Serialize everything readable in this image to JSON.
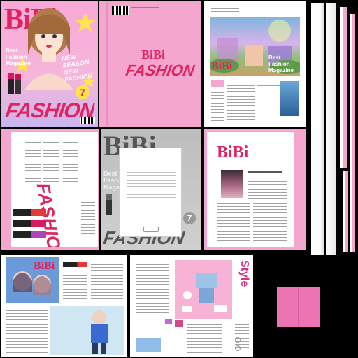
{
  "atlas": {
    "background": "#000000",
    "accent": "#e0245e",
    "pink": "#f4a6cf",
    "cover_bg": "#f7b3d6"
  },
  "cover": {
    "brand": "BiBi",
    "tagline_line1": "Best",
    "tagline_line2": "Fashion",
    "tagline_line3": "Magazine",
    "season_line1": "NEW",
    "season_line2": "SEASON",
    "season_line3": "NEW",
    "season_line4": "FASHION",
    "issue_number": "7",
    "headline": "FASHION"
  },
  "spine": {
    "brand": "BiBi",
    "headline": "FASHION"
  },
  "scene_page": {
    "brand": "BiBi",
    "tagline_line1": "Best",
    "tagline_line2": "Fashion",
    "tagline_line3": "Magazine"
  },
  "spread_fashion": {
    "headline": "FASHION"
  },
  "gray_cover": {
    "tagline_line1": "Best",
    "tagline_line2": "Fashion",
    "tagline_line3": "Magazine",
    "issue_number": "7",
    "headline": "FASHION"
  },
  "article_page": {
    "brand": "BiBi"
  },
  "comic_page": {
    "brand": "BiBi"
  },
  "style_page": {
    "heading": "Style"
  }
}
